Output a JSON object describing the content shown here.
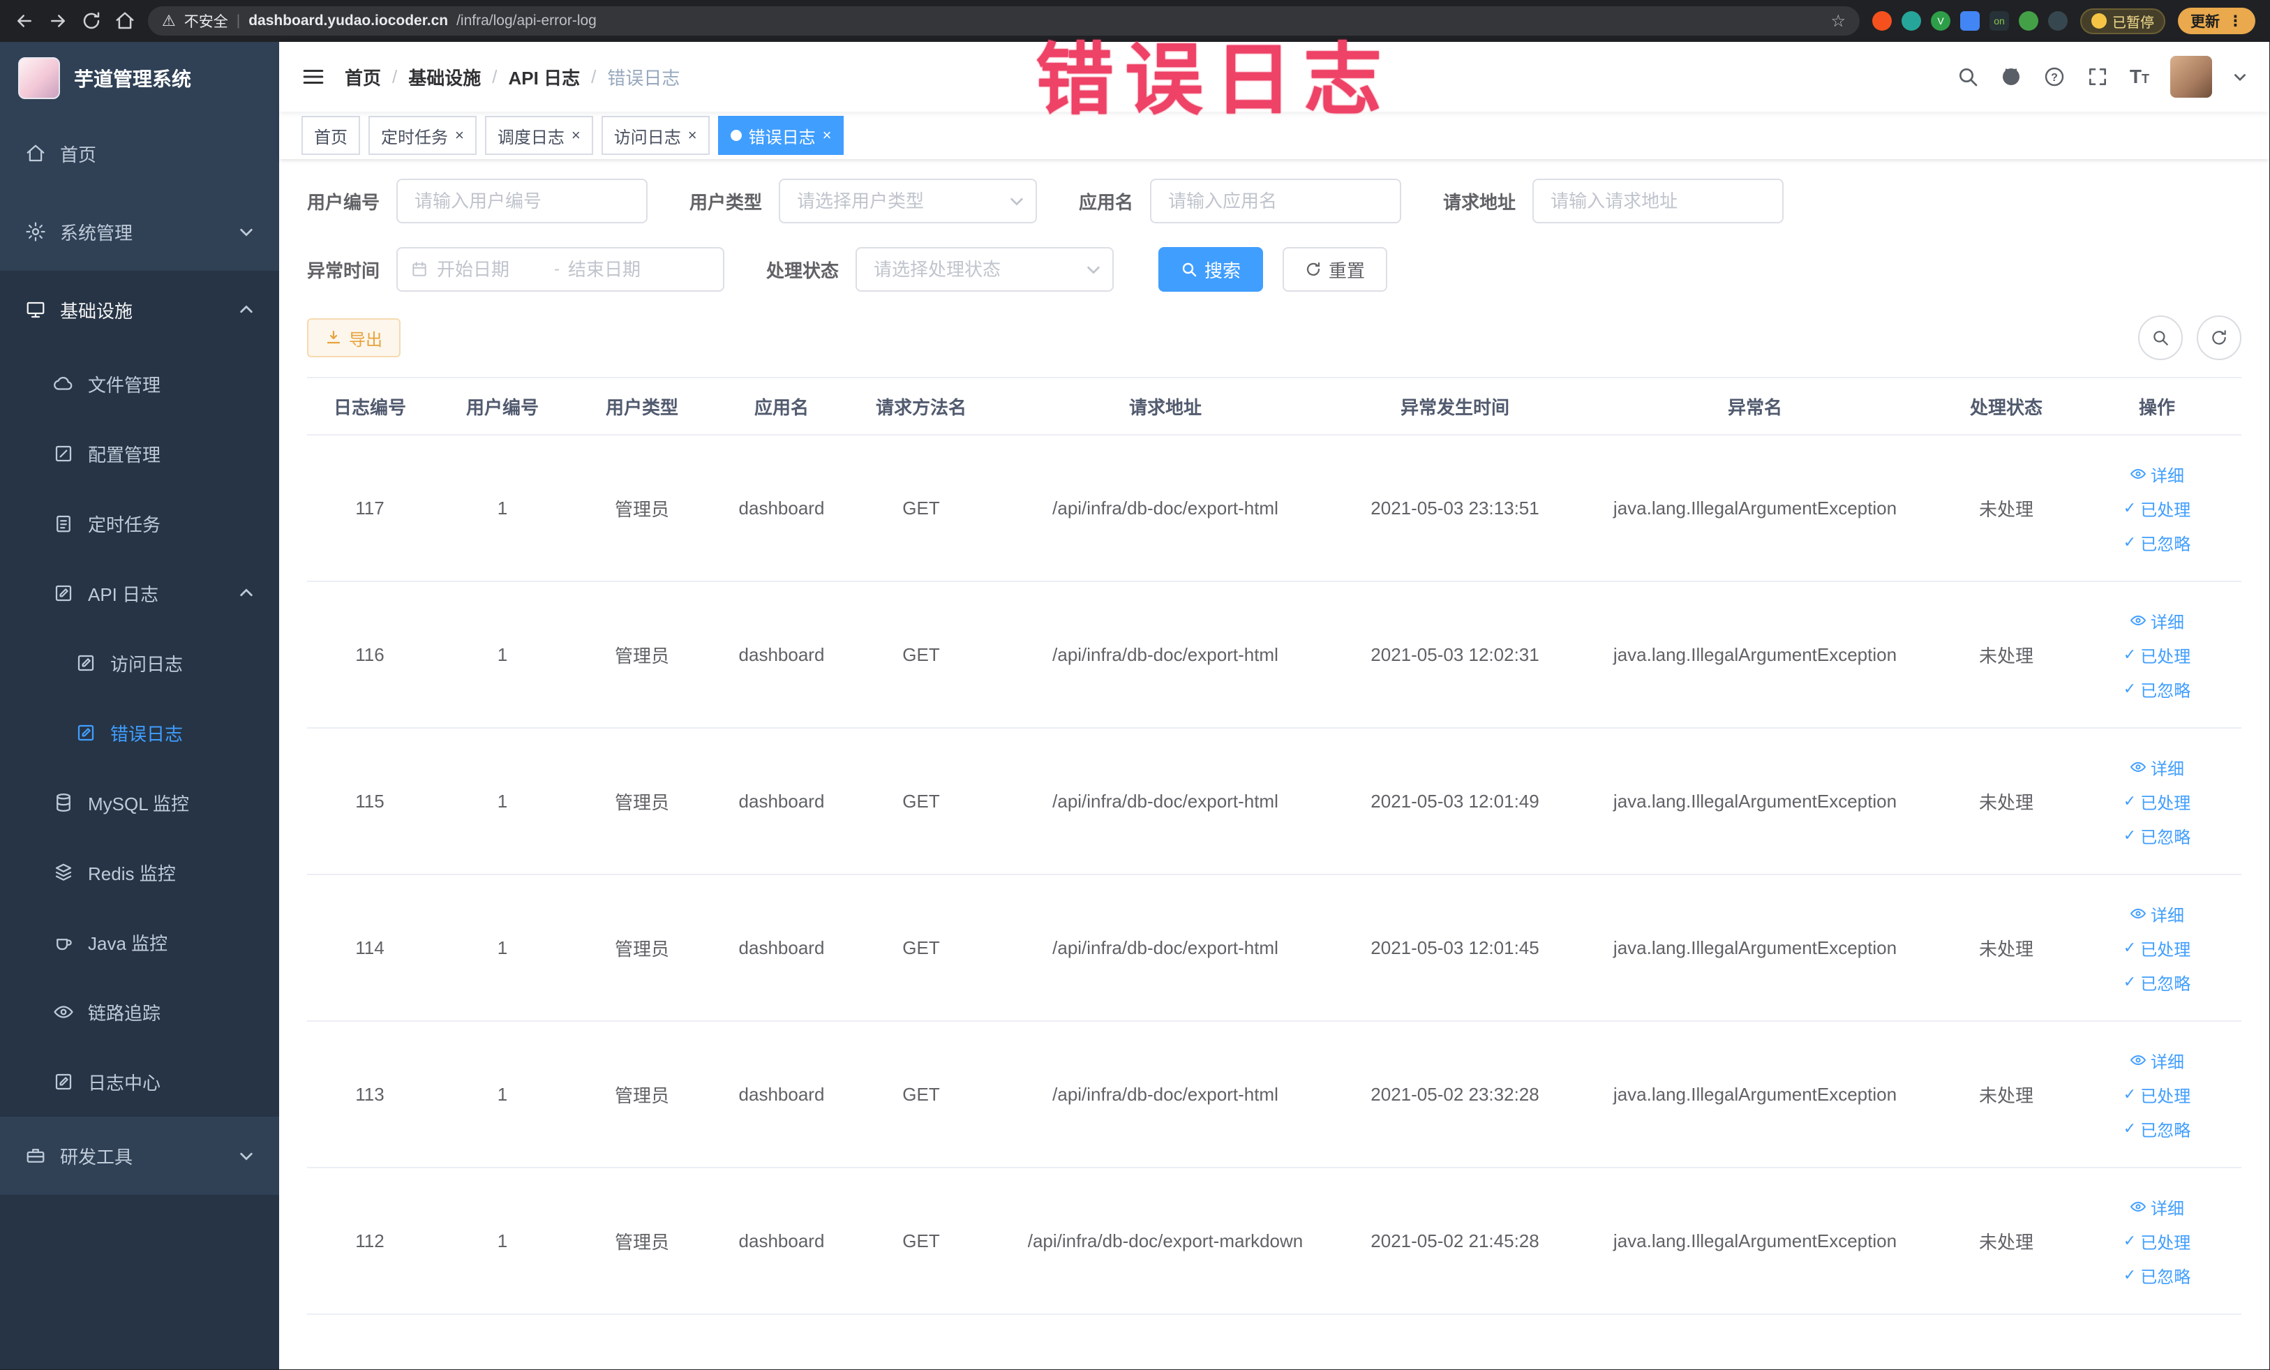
{
  "colors": {
    "accent": "#409eff",
    "warning": "#e6a23c",
    "annotation_red": "#ee4266",
    "sidebar_bg": "#304156"
  },
  "browser": {
    "security_label": "不安全",
    "url_domain": "dashboard.yudao.iocoder.cn",
    "url_path": "/infra/log/api-error-log",
    "paused_badge": "已暂停",
    "update_button": "更新"
  },
  "annotation": {
    "stamp": "错误日志"
  },
  "sidebar": {
    "logo_title": "芋道管理系统",
    "menu": {
      "home": "首页",
      "system_mgmt": "系统管理",
      "infrastructure": "基础设施",
      "file_mgmt": "文件管理",
      "config_mgmt": "配置管理",
      "scheduled_tasks": "定时任务",
      "api_log": "API 日志",
      "access_log": "访问日志",
      "error_log": "错误日志",
      "mysql_monitor": "MySQL 监控",
      "redis_monitor": "Redis 监控",
      "java_monitor": "Java 监控",
      "trace": "链路追踪",
      "log_center": "日志中心",
      "dev_tools": "研发工具"
    }
  },
  "breadcrumb": [
    "首页",
    "基础设施",
    "API 日志",
    "错误日志"
  ],
  "tabs": [
    {
      "label": "首页"
    },
    {
      "label": "定时任务"
    },
    {
      "label": "调度日志"
    },
    {
      "label": "访问日志"
    },
    {
      "label": "错误日志"
    }
  ],
  "filters": {
    "user_id_label": "用户编号",
    "user_id_placeholder": "请输入用户编号",
    "user_type_label": "用户类型",
    "user_type_placeholder": "请选择用户类型",
    "app_name_label": "应用名",
    "app_name_placeholder": "请输入应用名",
    "request_url_label": "请求地址",
    "request_url_placeholder": "请输入请求地址",
    "exception_time_label": "异常时间",
    "date_start_placeholder": "开始日期",
    "date_end_placeholder": "结束日期",
    "range_separator": "-",
    "process_status_label": "处理状态",
    "process_status_placeholder": "请选择处理状态",
    "search_button": "搜索",
    "reset_button": "重置"
  },
  "toolbar": {
    "export_button": "导出"
  },
  "table": {
    "columns": [
      "日志编号",
      "用户编号",
      "用户类型",
      "应用名",
      "请求方法名",
      "请求地址",
      "异常发生时间",
      "异常名",
      "处理状态",
      "操作"
    ],
    "action_labels": [
      "详细",
      "已处理",
      "已忽略"
    ],
    "rows": [
      {
        "log_id": "117",
        "user_id": "1",
        "user_type": "管理员",
        "app_name": "dashboard",
        "method": "GET",
        "url": "/api/infra/db-doc/export-html",
        "time": "2021-05-03 23:13:51",
        "exception": "java.lang.IllegalArgumentException",
        "status": "未处理"
      },
      {
        "log_id": "116",
        "user_id": "1",
        "user_type": "管理员",
        "app_name": "dashboard",
        "method": "GET",
        "url": "/api/infra/db-doc/export-html",
        "time": "2021-05-03 12:02:31",
        "exception": "java.lang.IllegalArgumentException",
        "status": "未处理"
      },
      {
        "log_id": "115",
        "user_id": "1",
        "user_type": "管理员",
        "app_name": "dashboard",
        "method": "GET",
        "url": "/api/infra/db-doc/export-html",
        "time": "2021-05-03 12:01:49",
        "exception": "java.lang.IllegalArgumentException",
        "status": "未处理"
      },
      {
        "log_id": "114",
        "user_id": "1",
        "user_type": "管理员",
        "app_name": "dashboard",
        "method": "GET",
        "url": "/api/infra/db-doc/export-html",
        "time": "2021-05-03 12:01:45",
        "exception": "java.lang.IllegalArgumentException",
        "status": "未处理"
      },
      {
        "log_id": "113",
        "user_id": "1",
        "user_type": "管理员",
        "app_name": "dashboard",
        "method": "GET",
        "url": "/api/infra/db-doc/export-html",
        "time": "2021-05-02 23:32:28",
        "exception": "java.lang.IllegalArgumentException",
        "status": "未处理"
      },
      {
        "log_id": "112",
        "user_id": "1",
        "user_type": "管理员",
        "app_name": "dashboard",
        "method": "GET",
        "url": "/api/infra/db-doc/export-markdown",
        "time": "2021-05-02 21:45:28",
        "exception": "java.lang.IllegalArgumentException",
        "status": "未处理"
      }
    ]
  }
}
